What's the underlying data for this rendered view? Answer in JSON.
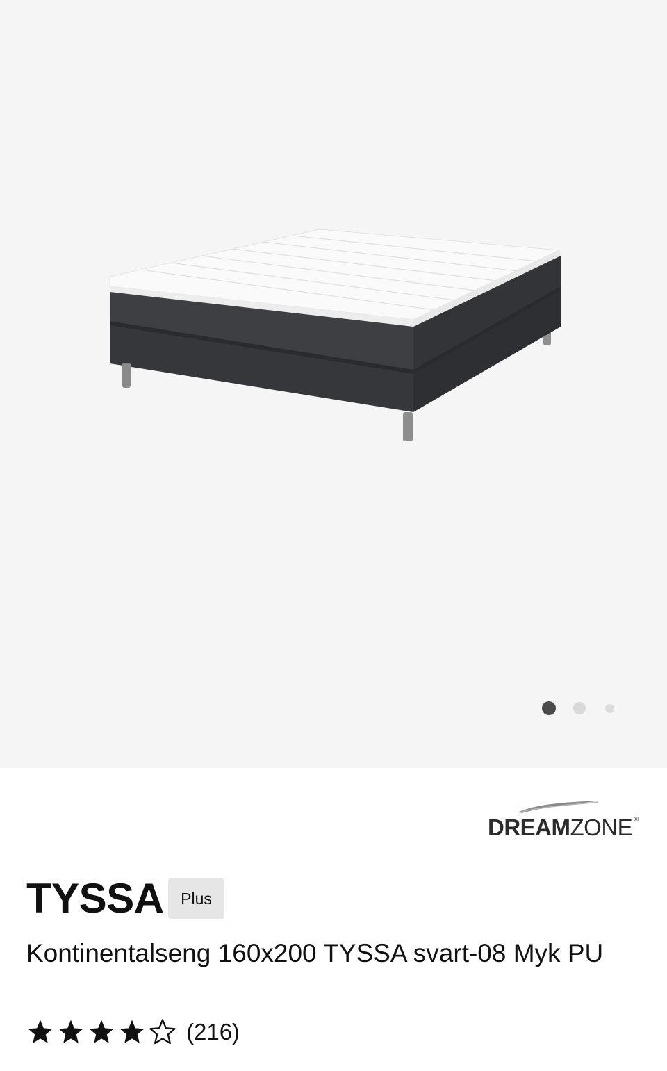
{
  "gallery": {
    "image_alt": "Kontinentalseng TYSSA",
    "active_index": 1,
    "total": 3
  },
  "brand": {
    "logo_bold": "DREAM",
    "logo_light": "ZONE",
    "registered": "®"
  },
  "product": {
    "name": "TYSSA",
    "badge": "Plus",
    "description": "Kontinentalseng 160x200 TYSSA svart-08 Myk PU",
    "rating": 4,
    "rating_max": 5,
    "review_count": "(216)"
  },
  "colors": {
    "gallery_bg": "#f5f5f5",
    "badge_bg": "#e6e6e6",
    "bed_fabric": "#3b3c3f",
    "mattress_top": "#fafafa"
  }
}
